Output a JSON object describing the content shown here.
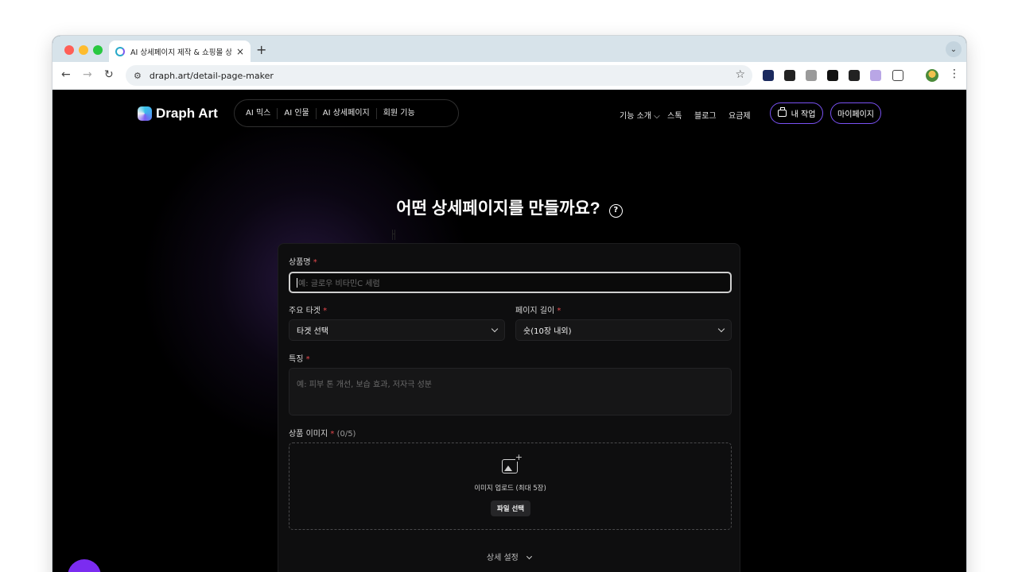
{
  "browser": {
    "tab_title": "AI 상세페이지 제작 & 쇼핑몰 상세페이지",
    "tab_close": "×",
    "new_tab": "+",
    "tab_menu": "⌄",
    "url": "draph.art/detail-page-maker",
    "back": "←",
    "forward": "→",
    "reload": "↻",
    "star": "☆",
    "menu": "⋮"
  },
  "header": {
    "logo_text": "Draph Art",
    "nav_pill": [
      "AI 믹스",
      "AI 인물",
      "AI 상세페이지",
      "회원 기능"
    ],
    "right_nav": {
      "features": "기능 소개 ⌵",
      "stock": "스톡",
      "blog": "블로그",
      "pricing": "요금제"
    },
    "my_work": "내 작업",
    "my_page": "마이페이지",
    "accent_color": "#7a52f4"
  },
  "main": {
    "title": "어떤 상세페이지를 만들까요?",
    "help": "?",
    "form": {
      "product_name": {
        "label": "상품명",
        "required": "*",
        "placeholder": "예: 글로우 비타민C 세럼"
      },
      "target": {
        "label": "주요 타겟",
        "required": "*",
        "value": "타겟 선택"
      },
      "page_length": {
        "label": "페이지 길이",
        "required": "*",
        "value": "숏(10장 내외)"
      },
      "features": {
        "label": "특징",
        "required": "*",
        "placeholder": "예: 피부 톤 개선, 보습 효과, 저자극 성분"
      },
      "images": {
        "label": "상품 이미지",
        "required": "*",
        "count": "(0/5)",
        "upload_text": "이미지 업로드 (최대 5장)",
        "file_button": "파일 선택"
      },
      "advanced_label": "상세 설정"
    }
  }
}
